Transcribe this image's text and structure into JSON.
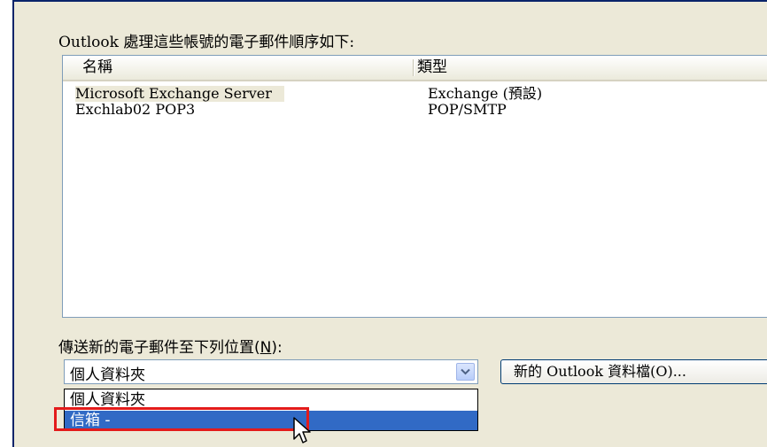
{
  "dialog": {
    "heading": "Outlook 處理這些帳號的電子郵件順序如下:",
    "columns": {
      "name": "名稱",
      "type": "類型"
    },
    "accounts": [
      {
        "name": "Microsoft Exchange Server",
        "type": "Exchange (預設)"
      },
      {
        "name": "Exchlab02 POP3",
        "type": "POP/SMTP"
      }
    ],
    "deliver_label": "傳送新的電子郵件至下列位置(",
    "deliver_mnemonic": "N",
    "deliver_label_end": "):",
    "combo_value": "個人資料夾",
    "new_file_button": "新的 Outlook 資料檔(O)...",
    "dropdown_options": [
      "個人資料夾",
      "信箱 -"
    ]
  },
  "colors": {
    "dialog_bg": "#ece9d8",
    "selection_bg": "#316ac5",
    "highlight_border": "#e31b1b"
  },
  "icons": [
    "chevron-down-icon",
    "mouse-pointer-icon"
  ]
}
